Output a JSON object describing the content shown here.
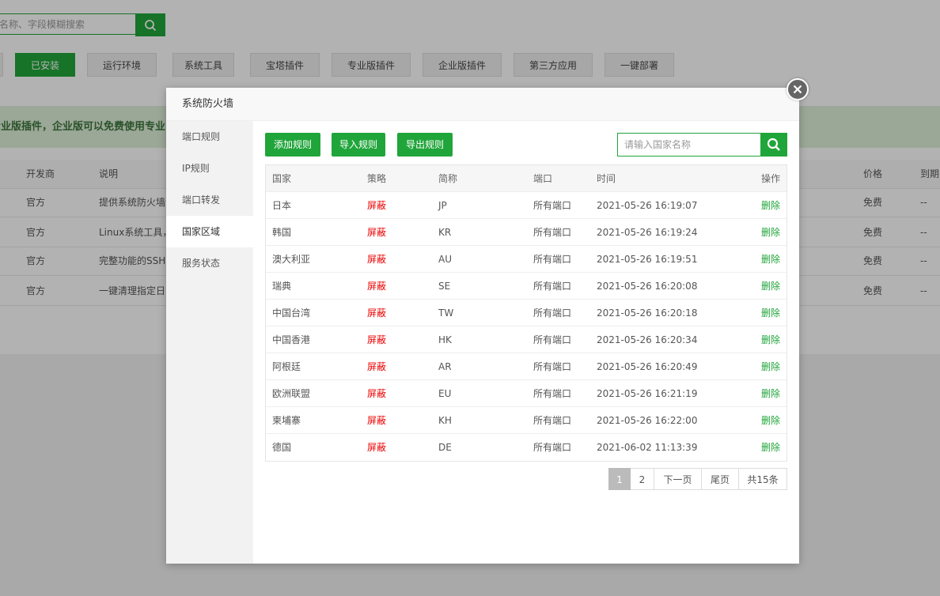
{
  "background": {
    "search_placeholder": "名称、字段模糊搜索",
    "tabs": [
      "已安装",
      "运行环境",
      "系统工具",
      "宝塔插件",
      "专业版插件",
      "企业版插件",
      "第三方应用",
      "一键部署"
    ],
    "banner_text": "专业版插件，企业版可以免费使用专业",
    "table_headers": {
      "developer": "开发商",
      "description": "说明",
      "price": "价格",
      "expire": "到期"
    },
    "rows": [
      {
        "developer": "官方",
        "description": "提供系统防火墙",
        "price": "免费",
        "expire": "--"
      },
      {
        "developer": "官方",
        "description": "Linux系统工具，",
        "price": "免费",
        "expire": "--"
      },
      {
        "developer": "官方",
        "description": "完整功能的SSH",
        "price": "免费",
        "expire": "--"
      },
      {
        "developer": "官方",
        "description": "一键清理指定日",
        "price": "免费",
        "expire": "--"
      }
    ]
  },
  "modal": {
    "title": "系统防火墙",
    "sidebar": [
      "端口规则",
      "IP规则",
      "端口转发",
      "国家区域",
      "服务状态"
    ],
    "active_sidebar_index": 3,
    "buttons": {
      "add": "添加规则",
      "import": "导入规则",
      "export": "导出规则"
    },
    "country_search_placeholder": "请输入国家名称",
    "table": {
      "headers": {
        "country": "国家",
        "policy": "策略",
        "code": "简称",
        "port": "端口",
        "time": "时间",
        "op": "操作"
      },
      "rows": [
        {
          "country": "日本",
          "policy": "屏蔽",
          "code": "JP",
          "port": "所有端口",
          "time": "2021-05-26 16:19:07",
          "op": "删除"
        },
        {
          "country": "韩国",
          "policy": "屏蔽",
          "code": "KR",
          "port": "所有端口",
          "time": "2021-05-26 16:19:24",
          "op": "删除"
        },
        {
          "country": "澳大利亚",
          "policy": "屏蔽",
          "code": "AU",
          "port": "所有端口",
          "time": "2021-05-26 16:19:51",
          "op": "删除"
        },
        {
          "country": "瑞典",
          "policy": "屏蔽",
          "code": "SE",
          "port": "所有端口",
          "time": "2021-05-26 16:20:08",
          "op": "删除"
        },
        {
          "country": "中国台湾",
          "policy": "屏蔽",
          "code": "TW",
          "port": "所有端口",
          "time": "2021-05-26 16:20:18",
          "op": "删除"
        },
        {
          "country": "中国香港",
          "policy": "屏蔽",
          "code": "HK",
          "port": "所有端口",
          "time": "2021-05-26 16:20:34",
          "op": "删除"
        },
        {
          "country": "阿根廷",
          "policy": "屏蔽",
          "code": "AR",
          "port": "所有端口",
          "time": "2021-05-26 16:20:49",
          "op": "删除"
        },
        {
          "country": "欧洲联盟",
          "policy": "屏蔽",
          "code": "EU",
          "port": "所有端口",
          "time": "2021-05-26 16:21:19",
          "op": "删除"
        },
        {
          "country": "柬埔寨",
          "policy": "屏蔽",
          "code": "KH",
          "port": "所有端口",
          "time": "2021-05-26 16:22:00",
          "op": "删除"
        },
        {
          "country": "德国",
          "policy": "屏蔽",
          "code": "DE",
          "port": "所有端口",
          "time": "2021-06-02 11:13:39",
          "op": "删除"
        }
      ]
    },
    "pagination": {
      "pages": [
        "1",
        "2"
      ],
      "current": "1",
      "next": "下一页",
      "last": "尾页",
      "total": "共15条"
    }
  },
  "colors": {
    "accent": "#20a53a",
    "danger": "#e00000",
    "banner_bg": "#dff0d8"
  }
}
